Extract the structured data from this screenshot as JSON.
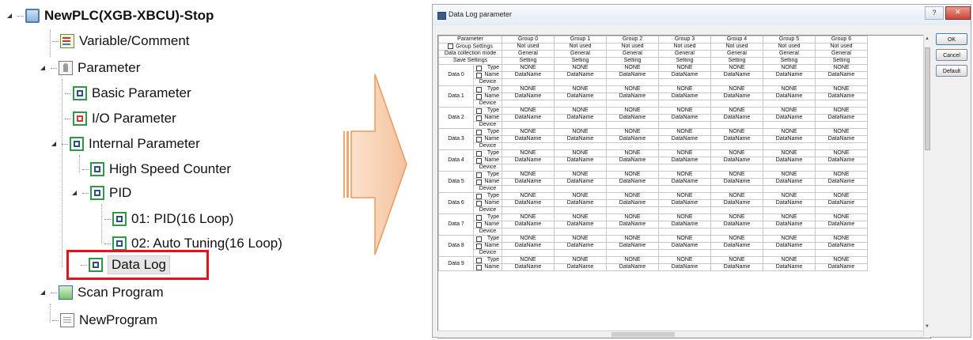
{
  "tree": {
    "root": "NewPLC(XGB-XBCU)-Stop",
    "variable_comment": "Variable/Comment",
    "parameter": "Parameter",
    "basic_parameter": "Basic Parameter",
    "io_parameter": "I/O Parameter",
    "internal_parameter": "Internal Parameter",
    "high_speed_counter": "High Speed Counter",
    "pid": "PID",
    "pid_loop": "01: PID(16 Loop)",
    "auto_tuning": "02: Auto Tuning(16 Loop)",
    "data_log": "Data Log",
    "scan_program": "Scan Program",
    "new_program": "NewProgram"
  },
  "dialog": {
    "title": "Data Log parameter",
    "help": "?",
    "buttons": {
      "ok": "OK",
      "cancel": "Cancel",
      "default": "Default"
    },
    "grid": {
      "parameter_header": "Parameter",
      "groups": [
        "Group 0",
        "Group 1",
        "Group 2",
        "Group 3",
        "Group 4",
        "Group 5",
        "Group 6"
      ],
      "group_settings_label": "Group Settings",
      "group_settings_value": "Not used",
      "collection_mode_label": "Data collection mode",
      "collection_mode_value": "General",
      "save_settings_label": "Save Settings",
      "save_settings_value": "Setting",
      "type_label": "Type",
      "name_label": "Name",
      "device_label": "Device",
      "type_value": "NONE",
      "name_value": "DataName",
      "data_rows": [
        "Data 0",
        "Data 1",
        "Data 2",
        "Data 3",
        "Data 4",
        "Data 5",
        "Data 6",
        "Data 7",
        "Data 8",
        "Data 9"
      ]
    }
  }
}
